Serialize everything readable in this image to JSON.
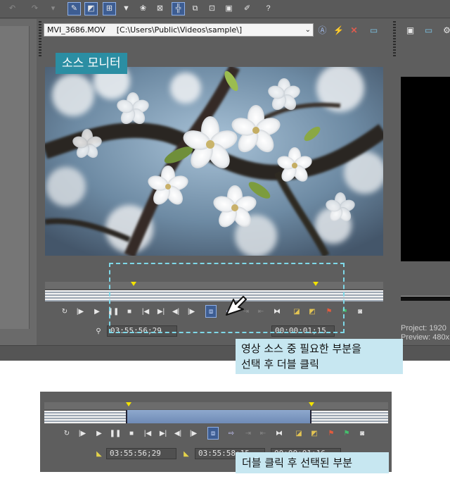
{
  "source_monitor": {
    "file_name": "MVI_3686.MOV",
    "file_path": "[C:\\Users\\Public\\Videos\\sample\\]",
    "title_overlay": "소스 모니터"
  },
  "timecodes": {
    "top_in": "03:55:56;29",
    "top_duration": "00:00:01;15",
    "bottom_in": "03:55:56;29",
    "bottom_out": "03:55:58;15",
    "bottom_duration": "00:00:01;16"
  },
  "project_info": {
    "project_line": "Project:  1920",
    "preview_line": "Preview:  480x"
  },
  "annotations": {
    "callout_top_line1": "영상 소스 중 필요한 부분을",
    "callout_top_line2": "선택 후 더블 클릭",
    "callout_bottom": "더블 클릭 후 선택된 부분"
  },
  "colors": {
    "panel_bg": "#5e5e5e",
    "active_button": "#3d5d92",
    "callout_bg": "#c7e7f1",
    "source_label_bg": "#2b8ea3",
    "selection_blue": "#7f99c2",
    "marker_yellow": "#f2e200"
  },
  "icons": {
    "transport": [
      "loop-icon",
      "play-from-start-icon",
      "play-icon",
      "pause-icon",
      "stop-icon",
      "prev-frame-icon",
      "next-frame-icon",
      "prev-marker-icon",
      "next-marker-icon",
      "trim-mode-icon",
      "add-to-timeline-icon",
      "set-in-icon",
      "set-out-icon",
      "clip-icon",
      "marker-flag-icon",
      "region-icon",
      "camera-icon"
    ]
  }
}
